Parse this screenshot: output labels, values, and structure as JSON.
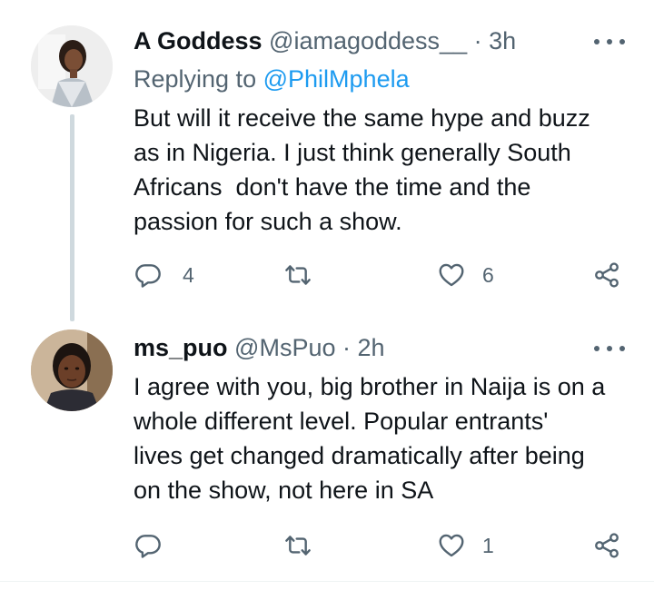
{
  "tweets": [
    {
      "name": "A Goddess",
      "handle": "@iamagoddess__",
      "dot": "·",
      "time": "3h",
      "replying_prefix": "Replying to",
      "replying_to": "@PhilMphela",
      "lines": [
        "But will it receive the same hype and buzz",
        "as in Nigeria. I just think generally South",
        "Africans  don't have the time and the",
        "passion for such a show."
      ],
      "replies": "4",
      "retweets": "",
      "likes": "6",
      "icons": {
        "more": "more-icon",
        "reply": "reply-icon",
        "retweet": "retweet-icon",
        "like": "heart-icon",
        "share": "share-icon"
      }
    },
    {
      "name": "ms_puo",
      "handle": "@MsPuo",
      "dot": "·",
      "time": "2h",
      "lines": [
        "I agree with you, big brother in Naija is on a",
        "whole different level. Popular entrants'",
        "lives get changed dramatically after being",
        "on the show, not here in SA"
      ],
      "replies": "",
      "retweets": "",
      "likes": "1",
      "icons": {
        "more": "more-icon",
        "reply": "reply-icon",
        "retweet": "retweet-icon",
        "like": "heart-icon",
        "share": "share-icon"
      }
    }
  ],
  "colors": {
    "text": "#0f1419",
    "secondary": "#536471",
    "link": "#1d9bf0",
    "thread_line": "#cfd9de"
  }
}
